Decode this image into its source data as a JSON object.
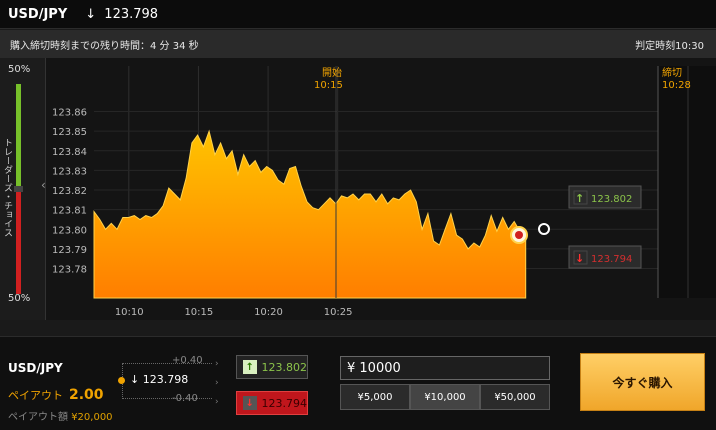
{
  "header": {
    "pair": "USD/JPY",
    "arrow": "↓",
    "price": "123.798"
  },
  "info": {
    "remaining": "購入締切時刻までの残り時間：4 分 34 秒",
    "judge_time": "判定時刻10:30"
  },
  "sentiment": {
    "top_pct": "50%",
    "bottom_pct": "50%",
    "label": "トレーダーズ・チョイス",
    "chevron": "‹"
  },
  "chart_labels": {
    "open_label": "開始",
    "open_time": "10:15",
    "close_label": "締切",
    "close_time": "10:28",
    "up_arrow": "↑",
    "down_arrow": "↓",
    "up_price": "123.802",
    "down_price": "123.794"
  },
  "chart_data": {
    "type": "area",
    "ylim": [
      123.765,
      123.872
    ],
    "xlim": [
      0,
      8.1
    ],
    "yticks": [
      123.86,
      123.85,
      123.84,
      123.83,
      123.82,
      123.81,
      123.8,
      123.79,
      123.78
    ],
    "ytick_labels": [
      "123.86",
      "123.85",
      "123.84",
      "123.83",
      "123.82",
      "123.81",
      "123.80",
      "123.79",
      "123.78"
    ],
    "xticks": [
      0.5,
      1.5,
      2.5,
      3.5
    ],
    "xtick_labels": [
      "10:10",
      "10:15",
      "10:20",
      "10:25"
    ],
    "grid": true,
    "series": [
      {
        "values": [
          123.809,
          123.805,
          123.8,
          123.803,
          123.8,
          123.806,
          123.806,
          123.807,
          123.805,
          123.807,
          123.806,
          123.808,
          123.812,
          123.821,
          123.818,
          123.815,
          123.826,
          123.844,
          123.848,
          123.842,
          123.85,
          123.838,
          123.844,
          123.836,
          123.84,
          123.828,
          123.838,
          123.832,
          123.835,
          123.829,
          123.832,
          123.83,
          123.825,
          123.823,
          123.831,
          123.832,
          123.822,
          123.814,
          123.811,
          123.81,
          123.813,
          123.816,
          123.813,
          123.817,
          123.816,
          123.818,
          123.815,
          123.818,
          123.818,
          123.814,
          123.818,
          123.813,
          123.816,
          123.815,
          123.818,
          123.82,
          123.814,
          123.8,
          123.808,
          123.794,
          123.792,
          123.8,
          123.808,
          123.797,
          123.795,
          123.79,
          123.793,
          123.791,
          123.797,
          123.807,
          123.799,
          123.806,
          123.8,
          123.804,
          123.799,
          123.798
        ]
      }
    ]
  },
  "bottom": {
    "pair": "USD/JPY",
    "payout_label": "ペイアウト",
    "payout_value": "2.00",
    "amount_label": "ペイアウト額",
    "amount_value": "¥20,000",
    "ladder_up": "+0.40",
    "ladder_down": "-0.40",
    "current_arrow": "↓",
    "current": "123.798",
    "chevron": "›",
    "up_price": "123.802",
    "down_price": "123.794",
    "amount_input": "¥ 10000",
    "presets": [
      "¥5,000",
      "¥10,000",
      "¥50,000"
    ],
    "buy_label": "今すぐ購入"
  },
  "colors": {
    "accent": "#f0a300",
    "up": "#8bc34a",
    "down": "#d32f2f"
  }
}
